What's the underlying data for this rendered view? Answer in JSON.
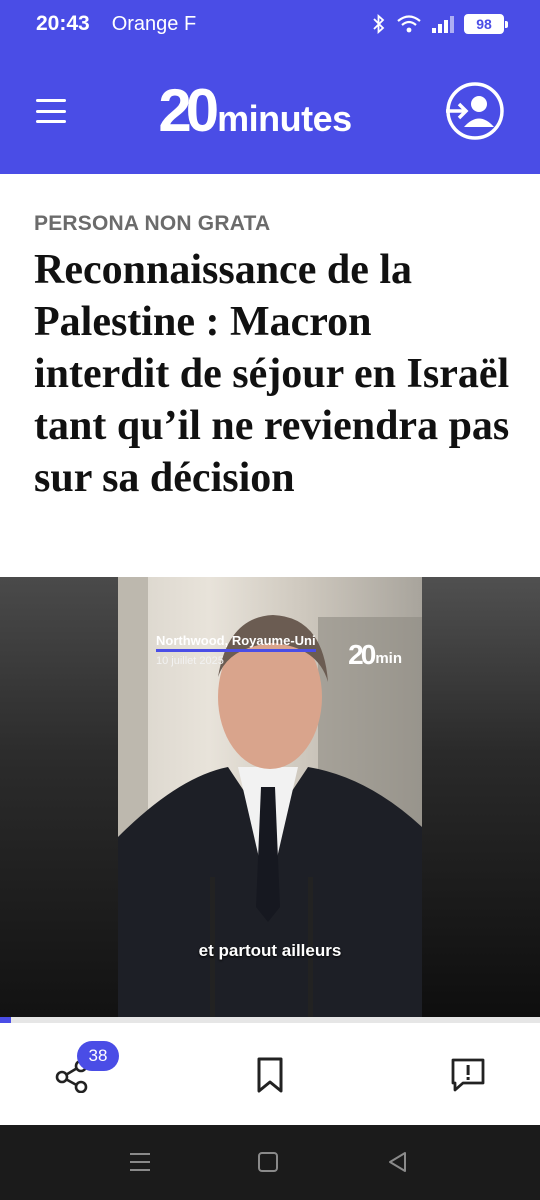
{
  "status_bar": {
    "time": "20:43",
    "carrier": "Orange F",
    "battery": "98",
    "icons": [
      "bluetooth-icon",
      "wifi-icon",
      "signal-icon",
      "battery-icon"
    ]
  },
  "header": {
    "logo_number": "20",
    "logo_word": "minutes",
    "icons": [
      "hamburger-menu-icon",
      "account-login-icon"
    ],
    "background_color": "#4a4de6"
  },
  "article": {
    "kicker": "PERSONA NON GRATA",
    "headline": "Reconnaissance de la Palestine : Macron interdit de séjour en Israël tant qu’il ne reviendra pas sur sa décision"
  },
  "video": {
    "location": "Northwood, Royaume-Uni",
    "date": "10 juillet 2025",
    "logo_number": "20",
    "logo_word": "min",
    "subtitle": "et partout ailleurs",
    "progress": 0.02
  },
  "actions": {
    "share_count": "38",
    "icons": [
      "share-icon",
      "bookmark-icon",
      "comment-alert-icon"
    ]
  },
  "nav_bar": {
    "icons": [
      "recent-apps-icon",
      "home-icon",
      "back-icon"
    ]
  }
}
